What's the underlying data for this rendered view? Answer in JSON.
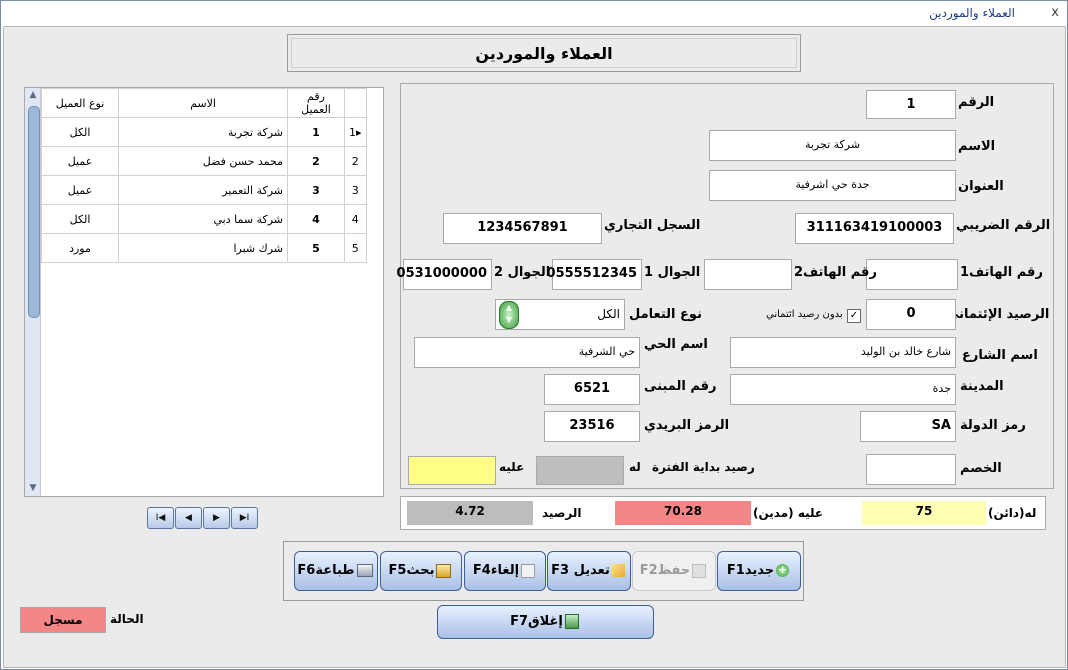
{
  "window": {
    "title": "العملاء والموردين",
    "close_glyph": "x"
  },
  "header": {
    "title": "العملاء والموردين"
  },
  "grid": {
    "columns": [
      "نوع العميل",
      "الاسم",
      "رقم العميل"
    ],
    "rows": [
      {
        "selector": "1▸",
        "num": "1",
        "name": "شركة تجربة",
        "type": "الكل"
      },
      {
        "selector": "2",
        "num": "2",
        "name": "محمد حسن فضل",
        "type": "عميل"
      },
      {
        "selector": "3",
        "num": "3",
        "name": "شركة التعمير",
        "type": "عميل"
      },
      {
        "selector": "4",
        "num": "4",
        "name": "شركة سما دبي",
        "type": "الكل"
      },
      {
        "selector": "5",
        "num": "5",
        "name": "شرك شبرا",
        "type": "مورد"
      }
    ]
  },
  "nav": {
    "first": "I◀",
    "prev": "◀",
    "next": "▶",
    "last": "▶I"
  },
  "form": {
    "number_label": "الرقم",
    "number_value": "1",
    "name_label": "الاسم",
    "name_value": "شركة تجربة",
    "address_label": "العنوان",
    "address_value": "جدة حي اشرفية",
    "tax_label": "الرقم الضريبي",
    "tax_value": "311163419100003",
    "cr_label": "السجل التجاري",
    "cr_value": "1234567891",
    "phone1_label": "رقم الهاتف1",
    "phone1_value": "",
    "phone2_label": "رقم الهاتف2",
    "phone2_value": "",
    "mobile1_label": "الجوال 1",
    "mobile1_value": "0555512345",
    "mobile2_label": "الجوال 2",
    "mobile2_value": "0531000000",
    "credit_label": "الرصيد الإئتماني",
    "credit_value": "0",
    "no_credit_label": "بدون رصيد ائتماني",
    "no_credit_checked": "✓",
    "deal_type_label": "نوع التعامل",
    "deal_type_value": "الكل",
    "street_label": "اسم الشارع",
    "street_value": "شارع خالد بن الوليد",
    "district_label": "اسم الحي",
    "district_value": "حي الشرفية",
    "city_label": "المدينة",
    "city_value": "جدة",
    "building_label": "رقم المبنى",
    "building_value": "6521",
    "country_label": "رمز الدولة",
    "country_value": "SA",
    "postal_label": "الرمز البريدي",
    "postal_value": "23516",
    "discount_label": "الخصم",
    "discount_value": "",
    "opening_label": "رصيد بداية الفترة",
    "opening_credit_label": "له",
    "opening_debit_label": "عليه"
  },
  "balance": {
    "credit_label": "له(دائن)",
    "credit_value": "75",
    "debit_label": "عليه (مدين)",
    "debit_value": "70.28",
    "balance_label": "الرصيد",
    "balance_value": "4.72"
  },
  "toolbar": {
    "new": "جديدF1",
    "save": "حفظF2",
    "edit": "تعديل F3",
    "cancel": "إلغاءF4",
    "search": "بحثF5",
    "print": "طباعةF6",
    "close": "إغلاقF7"
  },
  "status": {
    "label": "الحالة",
    "value": "مسجل"
  },
  "colors": {
    "credit": "#ffffb3",
    "debit": "#f58686",
    "balance": "#bdbdbd",
    "status": "#f58686"
  }
}
